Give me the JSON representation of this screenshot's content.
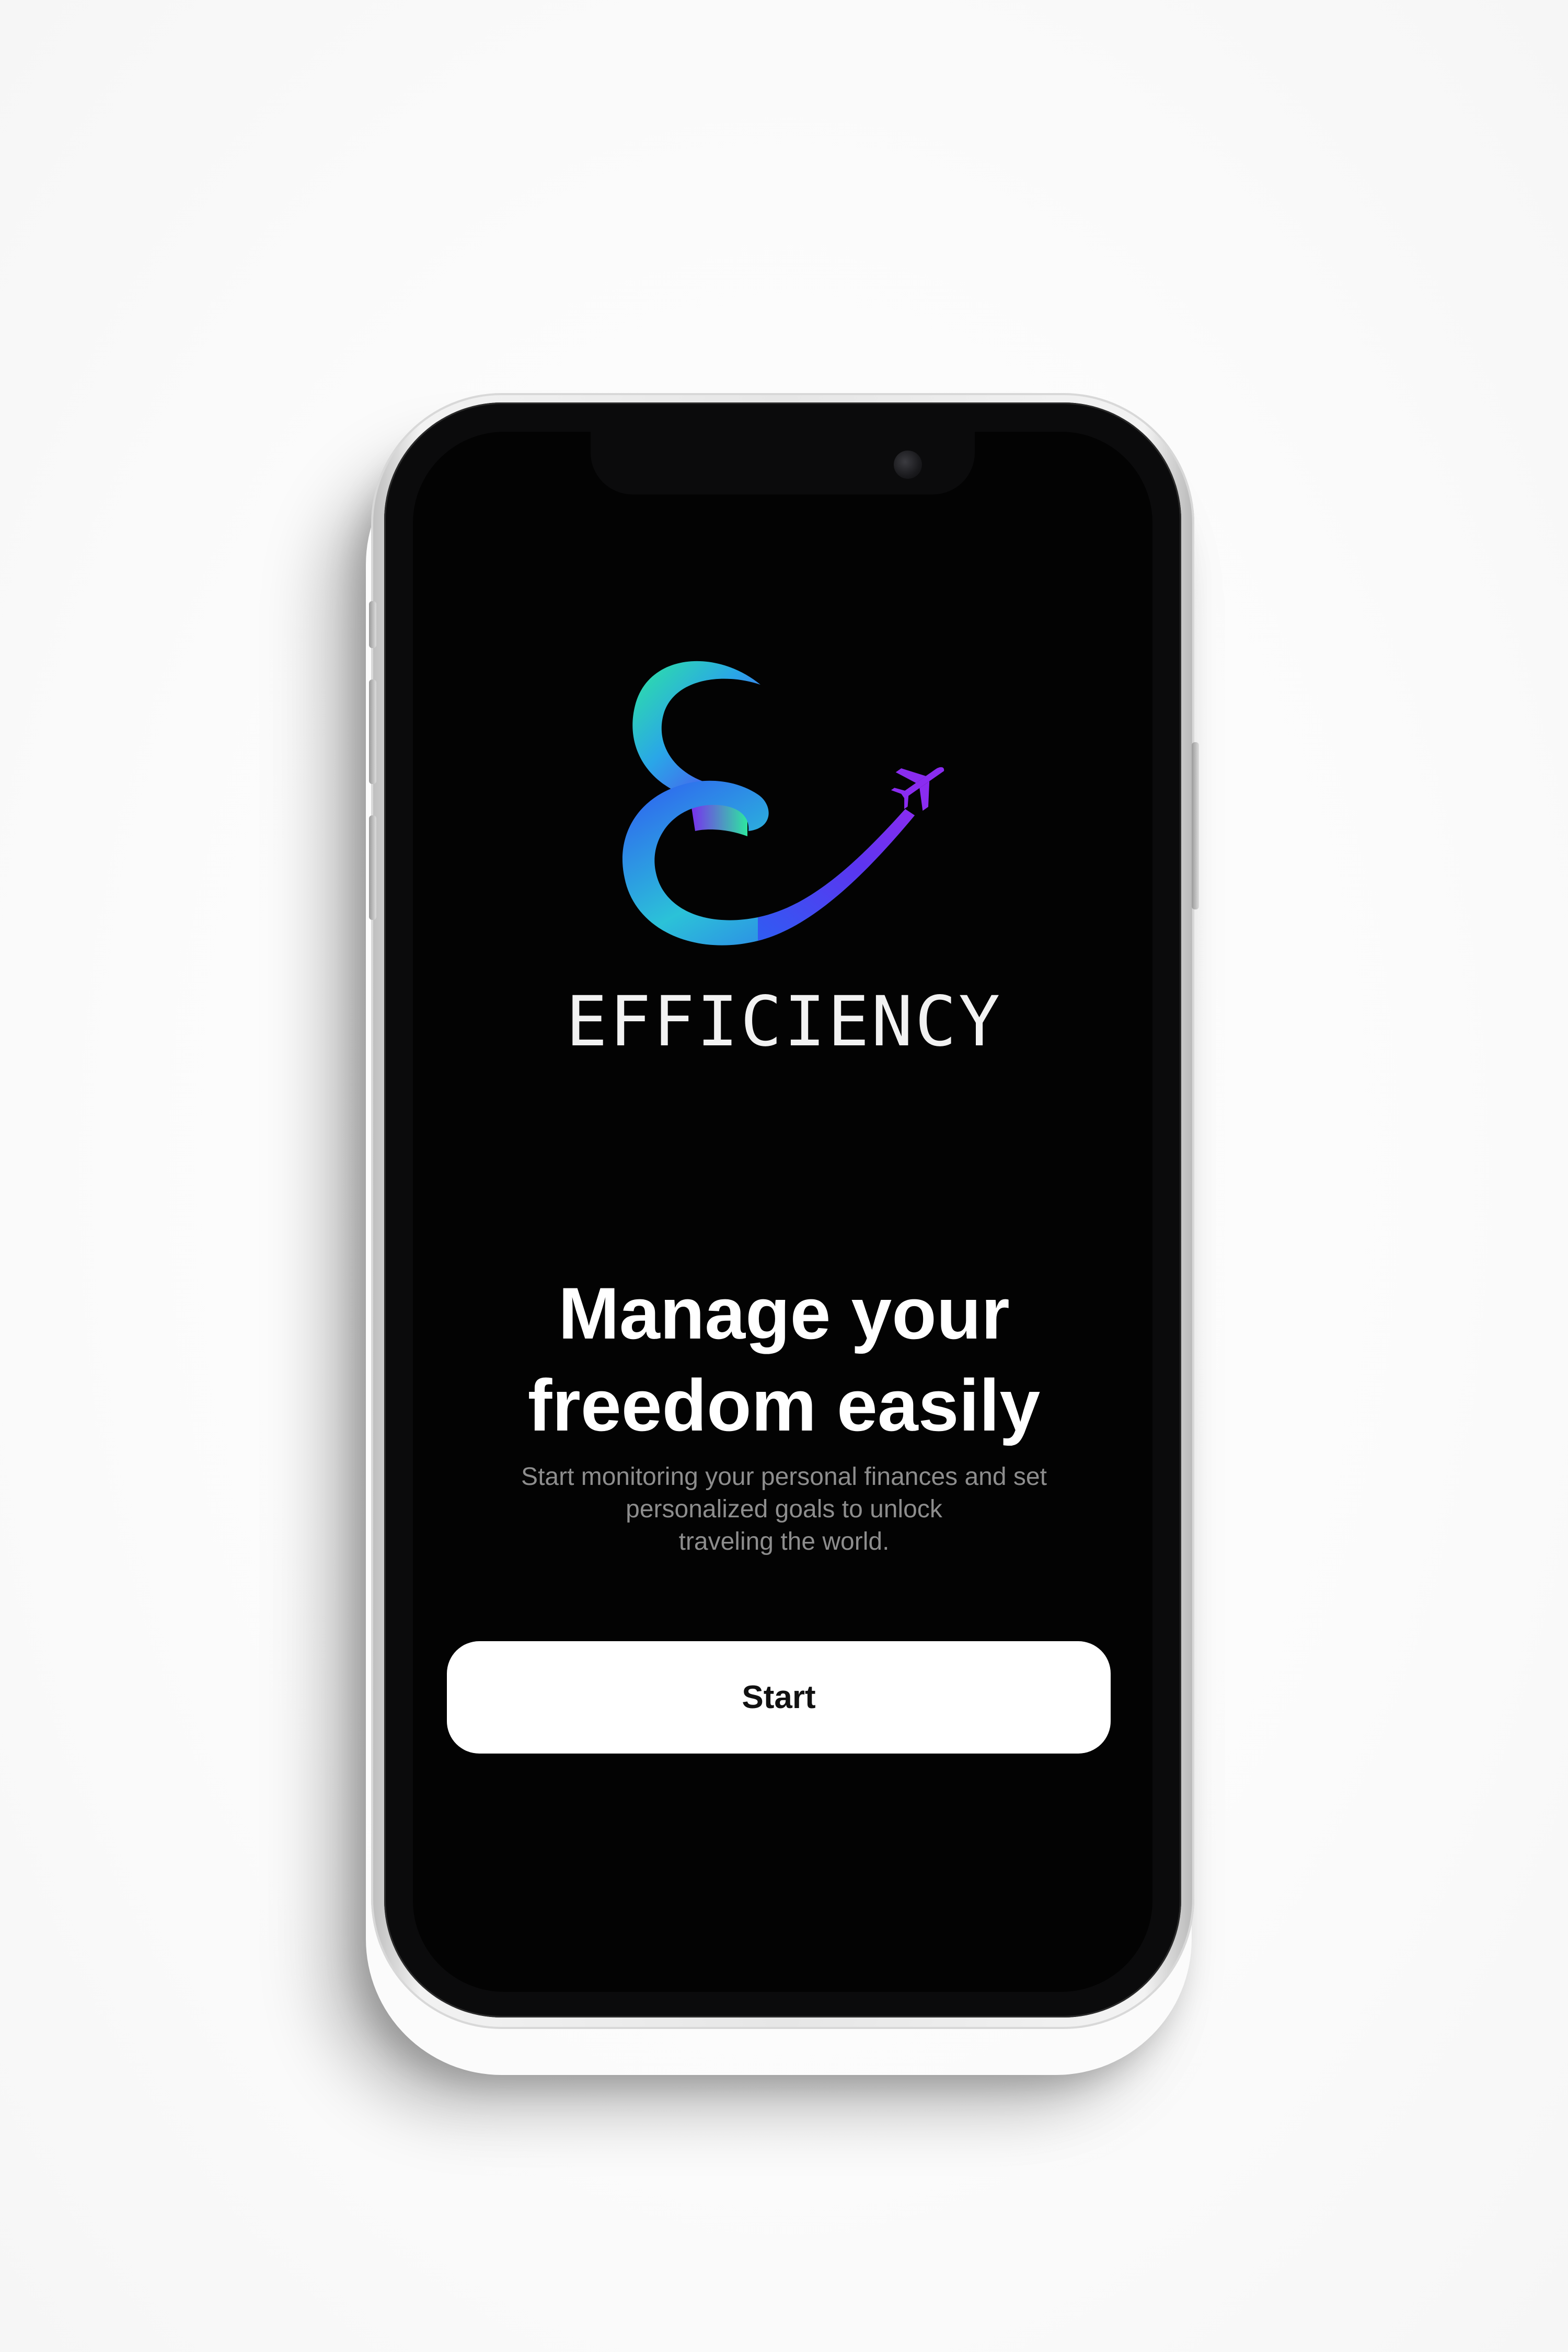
{
  "app": {
    "brand_name": "EFFICIENCY",
    "logo_icon": "e-airplane-logo-icon"
  },
  "onboarding": {
    "headline_line1": "Manage your",
    "headline_line2": "freedom easily",
    "subtext_line1": "Start monitoring your personal finances and set",
    "subtext_line2": "personalized goals to unlock",
    "subtext_line3": "traveling the world.",
    "start_label": "Start"
  },
  "colors": {
    "screen_background": "#030303",
    "button_background": "#ffffff",
    "logo_gradient_green": "#2ee6a0",
    "logo_gradient_blue": "#2f5cf2",
    "logo_gradient_purple": "#7a2cf0"
  }
}
